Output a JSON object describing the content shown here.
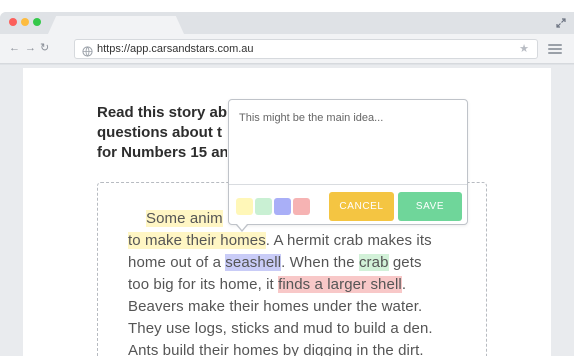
{
  "browser": {
    "url": "https://app.carsandstars.com.au",
    "icons": {
      "back": "arrow-left-icon",
      "forward": "arrow-right-icon",
      "reload": "reload-icon",
      "site": "globe-icon",
      "bookmark": "star-icon",
      "menu": "hamburger-menu-icon",
      "expand": "expand-icon"
    }
  },
  "content": {
    "heading_lines": [
      "Read this story ab",
      "questions about t",
      "for Numbers 15 an"
    ],
    "story_lines": [
      {
        "segments": [
          {
            "text": "Some anim",
            "hl": "yellow"
          }
        ]
      },
      {
        "segments": [
          {
            "text": "to make their homes",
            "hl": "yellow"
          },
          {
            "text": ". A hermit crab makes its",
            "hl": ""
          }
        ]
      },
      {
        "segments": [
          {
            "text": "home out of a ",
            "hl": ""
          },
          {
            "text": "seashell",
            "hl": "blue"
          },
          {
            "text": ". When the ",
            "hl": ""
          },
          {
            "text": "crab",
            "hl": "green"
          },
          {
            "text": " gets",
            "hl": ""
          }
        ]
      },
      {
        "segments": [
          {
            "text": "too big for its home, it ",
            "hl": ""
          },
          {
            "text": "finds a larger shell",
            "hl": "pink"
          },
          {
            "text": ".",
            "hl": ""
          }
        ]
      },
      {
        "segments": [
          {
            "text": "Beavers make their homes under the water.",
            "hl": ""
          }
        ]
      },
      {
        "segments": [
          {
            "text": "They use logs, sticks and mud to build a den.",
            "hl": ""
          }
        ]
      },
      {
        "segments": [
          {
            "text": "Ants build their homes by digging in the dirt.",
            "hl": ""
          }
        ]
      }
    ]
  },
  "popup": {
    "placeholder": "This might be the main idea...",
    "colors": [
      {
        "name": "yellow",
        "hex": "#fff7b8"
      },
      {
        "name": "green",
        "hex": "#c9f0d3"
      },
      {
        "name": "blue",
        "hex": "#a9aff7"
      },
      {
        "name": "pink",
        "hex": "#f6b3b3"
      }
    ],
    "cancel_label": "CANCEL",
    "save_label": "SAVE"
  },
  "colors": {
    "cancel_button": "#f4c542",
    "save_button": "#6fd69a"
  }
}
